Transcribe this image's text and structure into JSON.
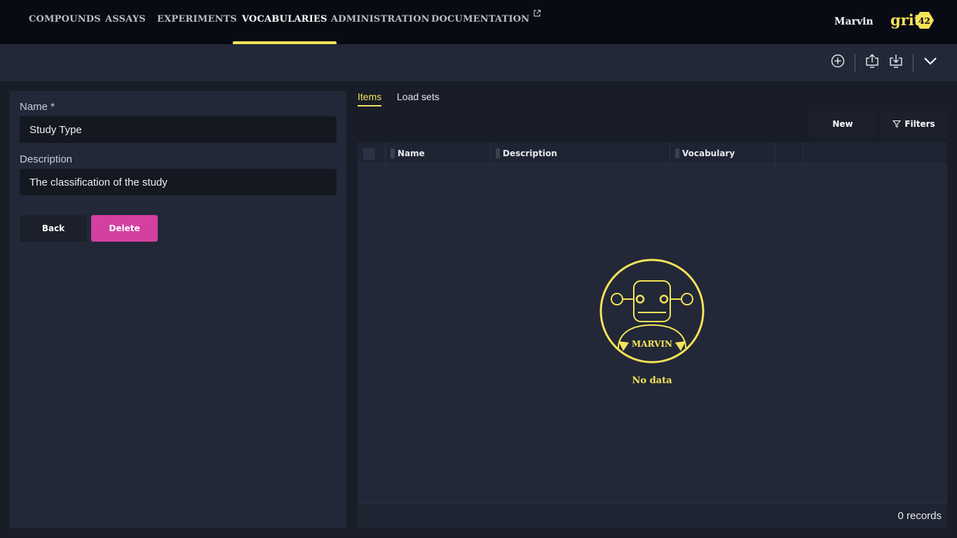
{
  "nav": {
    "items": [
      {
        "label": "COMPOUNDS"
      },
      {
        "label": "ASSAYS"
      },
      {
        "label": "EXPERIMENTS"
      },
      {
        "label": "VOCABULARIES",
        "active": true
      },
      {
        "label": "ADMINISTRATION"
      },
      {
        "label": "DOCUMENTATION",
        "external": true
      }
    ],
    "user_name": "Marvin",
    "logo_text": "grit",
    "logo_badge": "42",
    "accent_color": "#f5e35a"
  },
  "toolbar": {
    "icons": [
      "add-circle-icon",
      "upload-icon",
      "download-icon",
      "chevron-down-icon"
    ]
  },
  "form": {
    "name_label": "Name *",
    "name_value": "Study Type",
    "description_label": "Description",
    "description_value": "The classification of the study",
    "back_label": "Back",
    "delete_label": "Delete",
    "delete_color": "#d43fa2"
  },
  "tabs": [
    {
      "label": "Items",
      "active": true
    },
    {
      "label": "Load sets",
      "active": false
    }
  ],
  "actions": {
    "new_label": "New",
    "filters_label": "Filters"
  },
  "grid": {
    "columns": [
      "Name",
      "Description",
      "Vocabulary"
    ],
    "empty_badge_text": "MARVIN",
    "empty_message": "No data",
    "record_count": "0 records"
  }
}
